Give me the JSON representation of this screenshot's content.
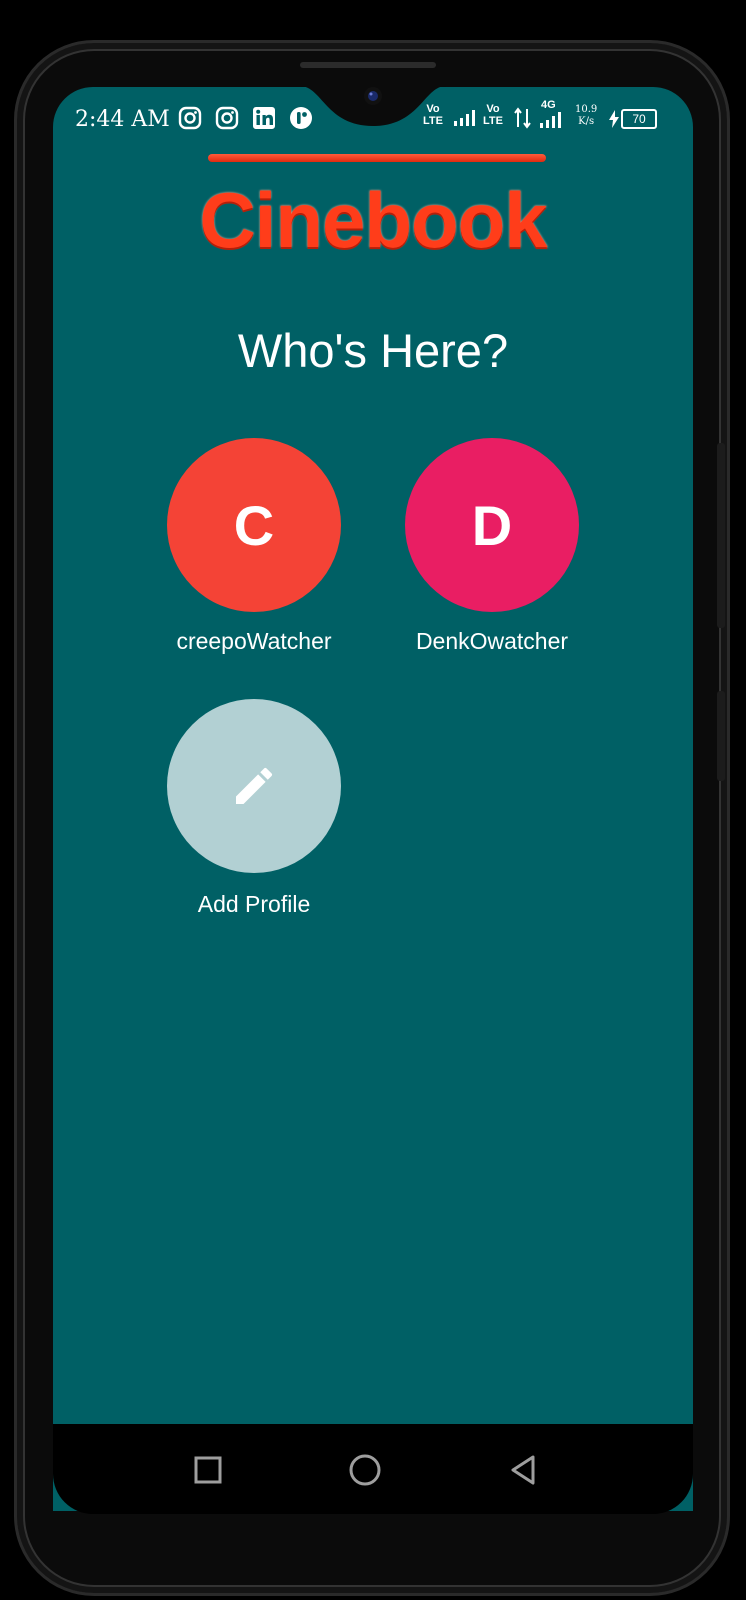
{
  "status_bar": {
    "time": "2:44 AM",
    "net1": "Vo\nLTE",
    "net2": "Vo\nLTE",
    "net3": "4G",
    "speed_value": "10.9",
    "speed_unit": "K/s",
    "battery": "70",
    "app_icons": [
      "instagram-icon",
      "instagram-icon",
      "linkedin-icon",
      "app-r-icon"
    ]
  },
  "app": {
    "logo": "Cinebook",
    "title": "Who's Here?",
    "colors": {
      "background": "#006065",
      "logo": "#ff3d1a"
    }
  },
  "profiles": [
    {
      "initial": "C",
      "name": "creepoWatcher",
      "color": "#f44336"
    },
    {
      "initial": "D",
      "name": "DenkOwatcher",
      "color": "#e91e63"
    }
  ],
  "add_profile": {
    "label": "Add Profile",
    "icon": "pencil-icon",
    "color": "#b2d0d3"
  },
  "nav": {
    "recent": "square-icon",
    "home": "circle-icon",
    "back": "triangle-back-icon"
  }
}
